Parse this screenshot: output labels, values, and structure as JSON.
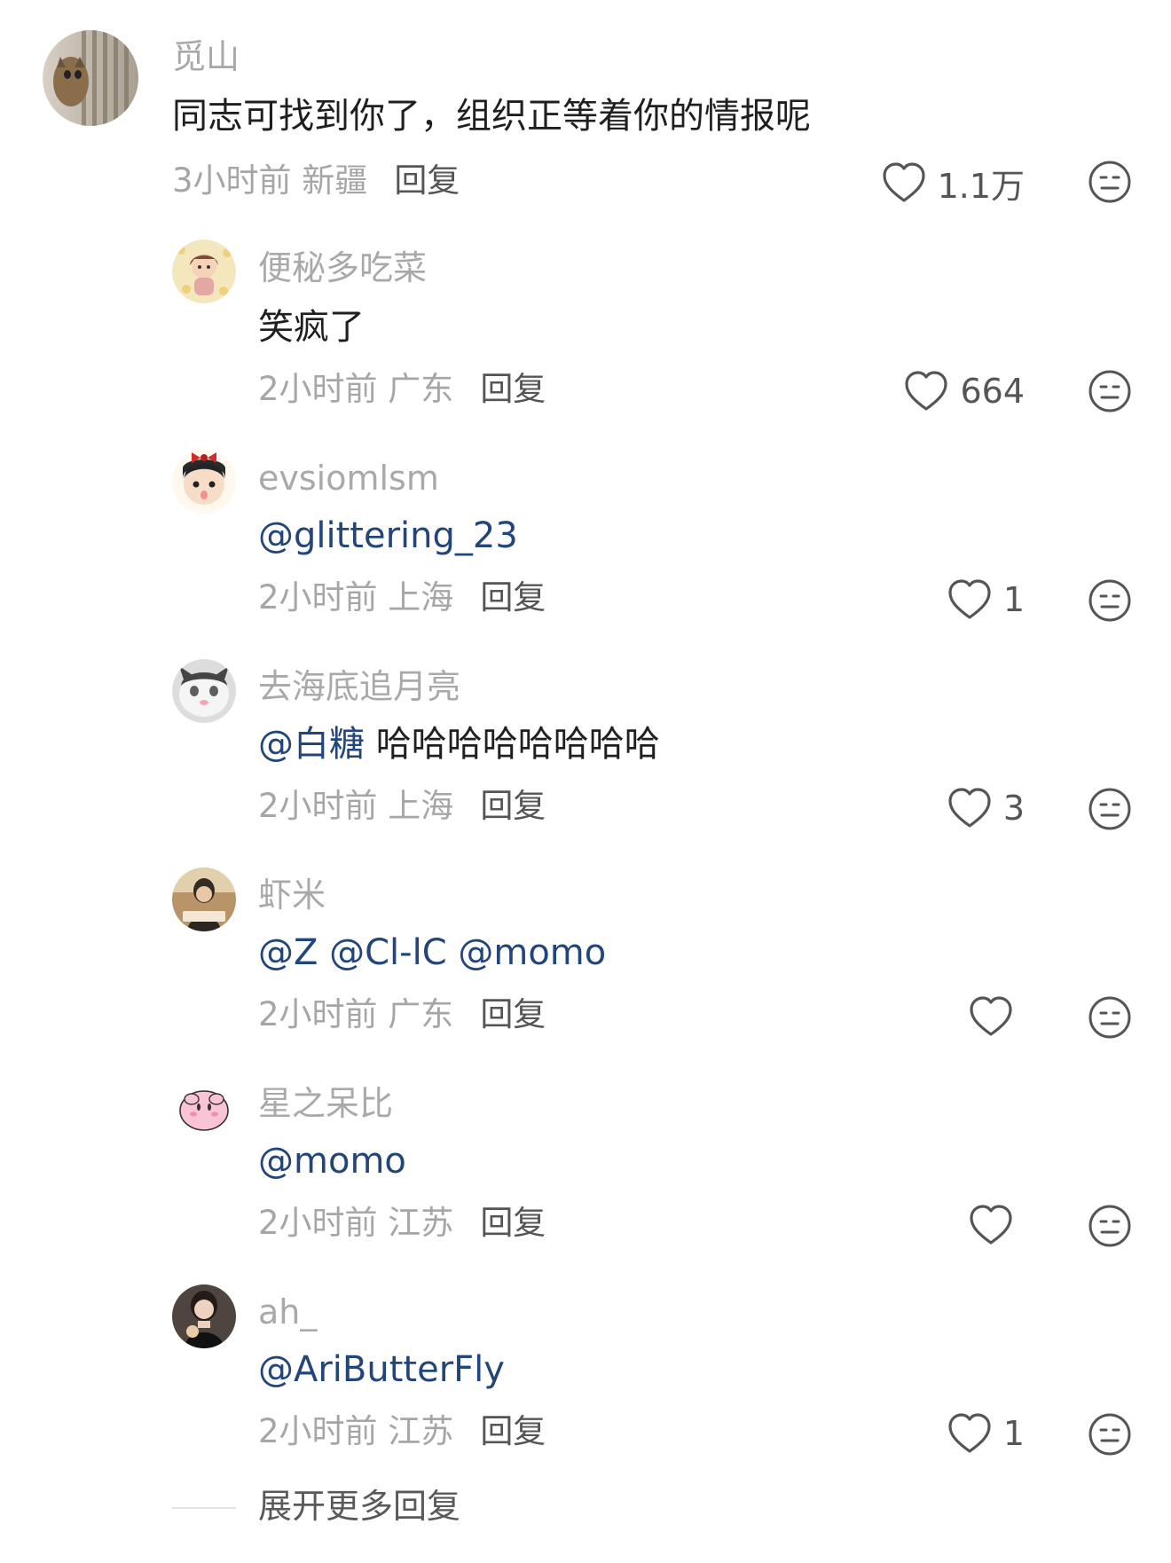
{
  "comment": {
    "author": "觅山",
    "text": "同志可找到你了，组织正等着你的情报呢",
    "time_location": "3小时前 新疆",
    "reply_label": "回复",
    "likes": "1.1万",
    "avatar_icon": "cat-peeking-avatar"
  },
  "replies": [
    {
      "author": "便秘多吃菜",
      "mention": "",
      "text": "笑疯了",
      "time_location": "2小时前 广东",
      "reply_label": "回复",
      "likes": "664",
      "avatar_icon": "cartoon-girl-avatar"
    },
    {
      "author": "evsiomlsm",
      "mention": "@glittering_23",
      "text": "",
      "time_location": "2小时前 上海",
      "reply_label": "回复",
      "likes": "1",
      "avatar_icon": "cartoon-girl-bow-avatar"
    },
    {
      "author": "去海底追月亮",
      "mention": "@白糖",
      "text": " 哈哈哈哈哈哈哈哈",
      "time_location": "2小时前 上海",
      "reply_label": "回复",
      "likes": "3",
      "avatar_icon": "cat-avatar"
    },
    {
      "author": "虾米",
      "mention": "@Z @Cl-lC @momo",
      "text": "",
      "time_location": "2小时前 广东",
      "reply_label": "回复",
      "likes": "",
      "avatar_icon": "person-reading-avatar"
    },
    {
      "author": "星之呆比",
      "mention": "@momo",
      "text": "",
      "time_location": "2小时前 江苏",
      "reply_label": "回复",
      "likes": "",
      "avatar_icon": "pink-kirby-avatar"
    },
    {
      "author": "ah_",
      "mention": "@AriButterFly",
      "text": "",
      "time_location": "2小时前 江苏",
      "reply_label": "回复",
      "likes": "1",
      "avatar_icon": "woman-portrait-avatar"
    }
  ],
  "expand_more_label": "展开更多回复",
  "colors": {
    "mention": "#23467a",
    "meta": "#a6a6a6",
    "text": "#1f1f1f"
  }
}
